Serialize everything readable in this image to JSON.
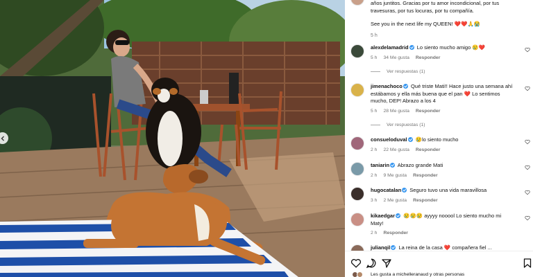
{
  "caption": {
    "line1": "años juntitos. Gracias por tu amor incondicional, por tus",
    "line2": "travesuras, por tus locuras, por tu compañía.",
    "line3": "See you in the next life my QUEEN! ❤️❤️🙏😭",
    "time": "5 h"
  },
  "comments": [
    {
      "user": "alexdelamadrid",
      "text": "Lo siento mucho amigo 😢❤️",
      "time": "5 h",
      "likes": "34 Me gusta",
      "reply": "Responder",
      "view_replies": "Ver respuestas (1)"
    },
    {
      "user": "jimenachoco",
      "text1": "Qué triste Mati!! Hace justo una semana ahí",
      "text2": "estábamos y ella más buena que el pan ❤️ Lo sentimos",
      "text3": "mucho, DEP! Abrazo a los 4",
      "time": "5 h",
      "likes": "28 Me gusta",
      "reply": "Responder",
      "view_replies": "Ver respuestas (1)"
    },
    {
      "user": "consueloduval",
      "text": "😢lo siento mucho",
      "time": "2 h",
      "likes": "22 Me gusta",
      "reply": "Responder"
    },
    {
      "user": "taniarin",
      "text": "Abrazo grande Mati",
      "time": "2 h",
      "likes": "9 Me gusta",
      "reply": "Responder"
    },
    {
      "user": "hugocatalan",
      "text": "Seguro tuvo una vida maravillosa",
      "time": "3 h",
      "likes": "2 Me gusta",
      "reply": "Responder"
    },
    {
      "user": "kikaedgar",
      "text1": "😢😢😢 ayyyy nooool Lo siento mucho mi",
      "text2": "Maty!",
      "time": "2 h",
      "reply": "Responder"
    },
    {
      "user": "julianqil",
      "text": "La reina de la casa ❤️ compañera fiel ..."
    }
  ],
  "likes_line": "Les gusta a michelleranaud y otras personas",
  "colors": {
    "verified": "#3897f0",
    "link": "#00376b",
    "muted": "#737373"
  },
  "icons": [
    "heart-icon",
    "comment-icon",
    "share-icon",
    "bookmark-icon",
    "chevron-left-icon",
    "verified-badge-icon"
  ]
}
